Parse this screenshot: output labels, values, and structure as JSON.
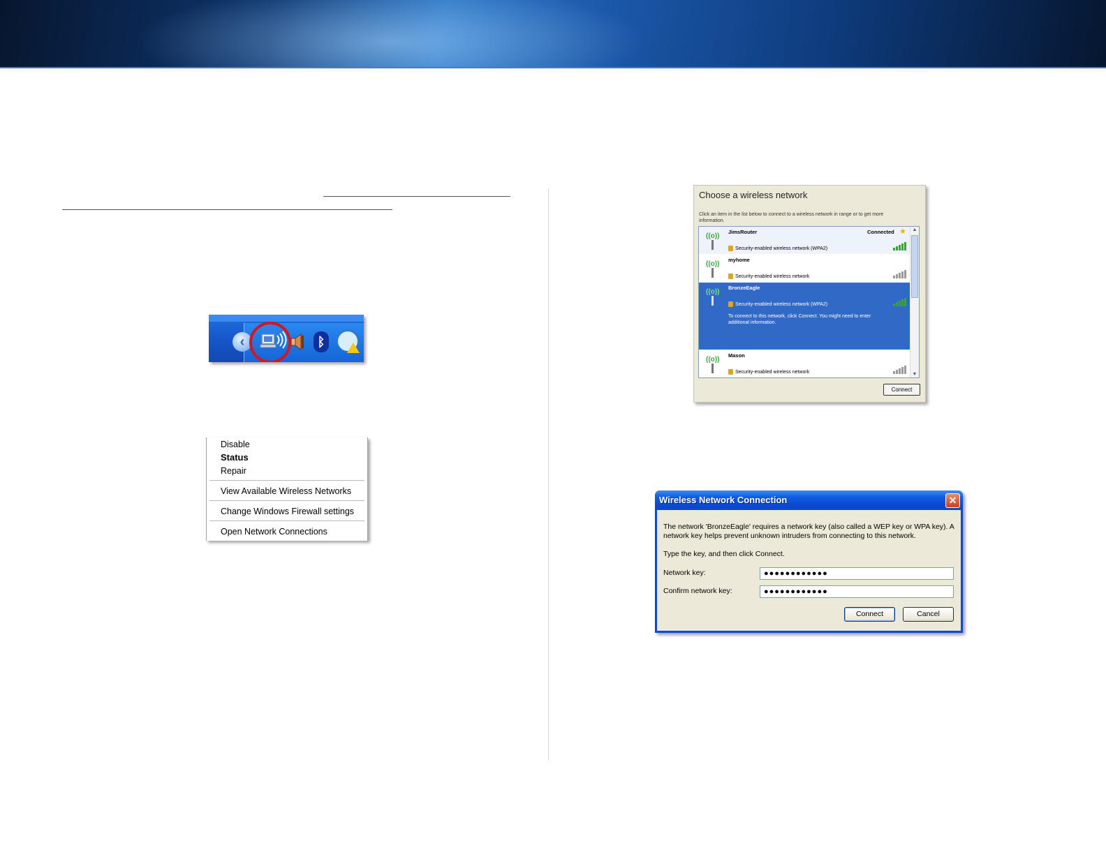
{
  "tray": {
    "icons": [
      "chevron-left-icon",
      "wireless-network-icon",
      "volume-icon",
      "bluetooth-icon",
      "network-warning-icon"
    ],
    "highlight_color": "#d8141c"
  },
  "context_menu": {
    "items": [
      {
        "label": "Disable",
        "bold": false
      },
      {
        "label": "Status",
        "bold": true
      },
      {
        "label": "Repair",
        "bold": false
      },
      {
        "label": "View Available Wireless Networks",
        "bold": false
      },
      {
        "label": "Change Windows Firewall settings",
        "bold": false
      },
      {
        "label": "Open Network Connections",
        "bold": false
      }
    ]
  },
  "wireless_list": {
    "title": "Choose a wireless network",
    "description": "Click an item in the list below to connect to a wireless network in range or to get more information.",
    "networks": [
      {
        "name": "JimsRouter",
        "security": "Security-enabled wireless network (WPA2)",
        "status": "Connected",
        "selected": false
      },
      {
        "name": "myhome",
        "security": "Security-enabled wireless network",
        "status": "",
        "selected": false
      },
      {
        "name": "BronzeEagle",
        "security": "Security-enabled wireless network (WPA2)",
        "status": "",
        "selected": true,
        "note": "To connect to this network, click Connect. You might need to enter additional information."
      },
      {
        "name": "Mason",
        "security": "Security-enabled wireless network",
        "status": "",
        "selected": false
      }
    ],
    "connect_label": "Connect"
  },
  "dialog": {
    "title": "Wireless Network Connection",
    "message": "The network 'BronzeEagle' requires a network key (also called a WEP key or WPA key). A network key helps prevent unknown intruders from connecting to this network.",
    "instruction": "Type the key, and then click Connect.",
    "network_key_label": "Network key:",
    "network_key_value": "●●●●●●●●●●●●",
    "confirm_key_label": "Confirm network key:",
    "confirm_key_value": "●●●●●●●●●●●●",
    "connect_label": "Connect",
    "cancel_label": "Cancel",
    "close_glyph": "✕"
  },
  "colors": {
    "xp_title_blue": "#0a4bd3",
    "selection_blue": "#3169c6",
    "dialog_face": "#ece9d8"
  }
}
